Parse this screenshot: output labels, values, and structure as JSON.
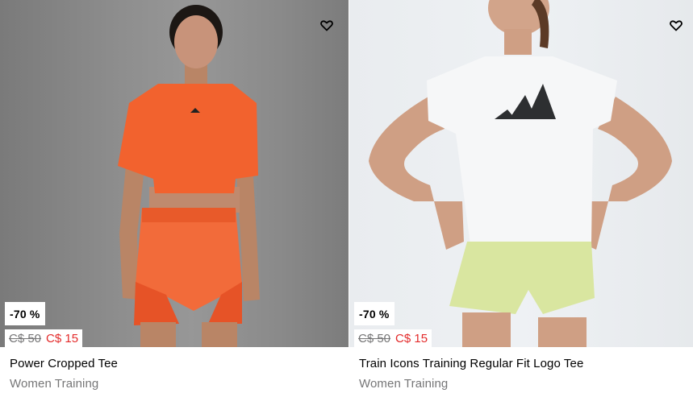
{
  "products": [
    {
      "discount": "-70 %",
      "old_price": "C$ 50",
      "new_price": "C$ 15",
      "title": "Power Cropped Tee",
      "category": "Women Training",
      "wishlist_icon": "heart-icon"
    },
    {
      "discount": "-70 %",
      "old_price": "C$ 50",
      "new_price": "C$ 15",
      "title": "Train Icons Training Regular Fit Logo Tee",
      "category": "Women Training",
      "wishlist_icon": "heart-icon"
    }
  ],
  "colors": {
    "sale_price": "#e32b2b",
    "muted_text": "#767677",
    "tee_orange": "#f2622e",
    "tee_white": "#f6f7f8",
    "shorts_lime": "#d9e6a0"
  }
}
